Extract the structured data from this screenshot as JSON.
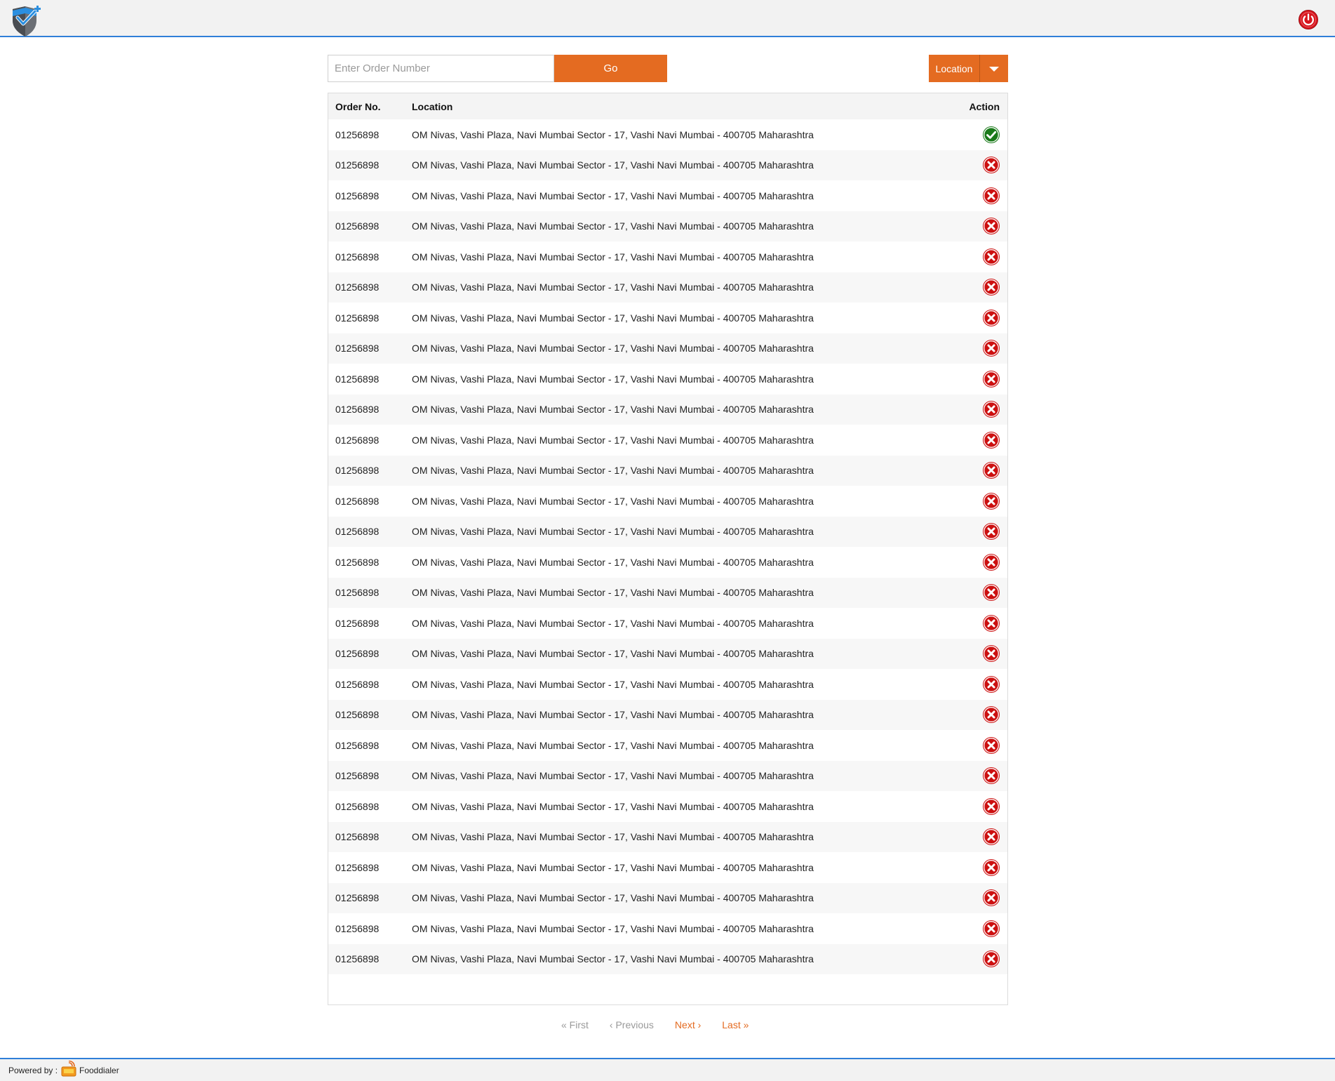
{
  "header": {
    "logo_icon": "shield-check-logo-icon",
    "power_icon": "power-icon"
  },
  "search": {
    "placeholder": "Enter Order Number",
    "value": "",
    "go_label": "Go"
  },
  "location_dropdown": {
    "label": "Location",
    "caret_icon": "caret-down-icon"
  },
  "table": {
    "headers": [
      "Order No.",
      "Location",
      "Action"
    ],
    "rows": [
      {
        "order_no": "01256898",
        "location": "OM Nivas, Vashi Plaza, Navi Mumbai Sector - 17, Vashi Navi Mumbai - 400705 Maharashtra",
        "action": "approved"
      },
      {
        "order_no": "01256898",
        "location": "OM Nivas, Vashi Plaza, Navi Mumbai Sector - 17, Vashi Navi Mumbai - 400705 Maharashtra",
        "action": "rejected"
      },
      {
        "order_no": "01256898",
        "location": "OM Nivas, Vashi Plaza, Navi Mumbai Sector - 17, Vashi Navi Mumbai - 400705 Maharashtra",
        "action": "rejected"
      },
      {
        "order_no": "01256898",
        "location": "OM Nivas, Vashi Plaza, Navi Mumbai Sector - 17, Vashi Navi Mumbai - 400705 Maharashtra",
        "action": "rejected"
      },
      {
        "order_no": "01256898",
        "location": "OM Nivas, Vashi Plaza, Navi Mumbai Sector - 17, Vashi Navi Mumbai - 400705 Maharashtra",
        "action": "rejected"
      },
      {
        "order_no": "01256898",
        "location": "OM Nivas, Vashi Plaza, Navi Mumbai Sector - 17, Vashi Navi Mumbai - 400705 Maharashtra",
        "action": "rejected"
      },
      {
        "order_no": "01256898",
        "location": "OM Nivas, Vashi Plaza, Navi Mumbai Sector - 17, Vashi Navi Mumbai - 400705 Maharashtra",
        "action": "rejected"
      },
      {
        "order_no": "01256898",
        "location": "OM Nivas, Vashi Plaza, Navi Mumbai Sector - 17, Vashi Navi Mumbai - 400705 Maharashtra",
        "action": "rejected"
      },
      {
        "order_no": "01256898",
        "location": "OM Nivas, Vashi Plaza, Navi Mumbai Sector - 17, Vashi Navi Mumbai - 400705 Maharashtra",
        "action": "rejected"
      },
      {
        "order_no": "01256898",
        "location": "OM Nivas, Vashi Plaza, Navi Mumbai Sector - 17, Vashi Navi Mumbai - 400705 Maharashtra",
        "action": "rejected"
      },
      {
        "order_no": "01256898",
        "location": "OM Nivas, Vashi Plaza, Navi Mumbai Sector - 17, Vashi Navi Mumbai - 400705 Maharashtra",
        "action": "rejected"
      },
      {
        "order_no": "01256898",
        "location": "OM Nivas, Vashi Plaza, Navi Mumbai Sector - 17, Vashi Navi Mumbai - 400705 Maharashtra",
        "action": "rejected"
      },
      {
        "order_no": "01256898",
        "location": "OM Nivas, Vashi Plaza, Navi Mumbai Sector - 17, Vashi Navi Mumbai - 400705 Maharashtra",
        "action": "rejected"
      },
      {
        "order_no": "01256898",
        "location": "OM Nivas, Vashi Plaza, Navi Mumbai Sector - 17, Vashi Navi Mumbai - 400705 Maharashtra",
        "action": "rejected"
      },
      {
        "order_no": "01256898",
        "location": "OM Nivas, Vashi Plaza, Navi Mumbai Sector - 17, Vashi Navi Mumbai - 400705 Maharashtra",
        "action": "rejected"
      },
      {
        "order_no": "01256898",
        "location": "OM Nivas, Vashi Plaza, Navi Mumbai Sector - 17, Vashi Navi Mumbai - 400705 Maharashtra",
        "action": "rejected"
      },
      {
        "order_no": "01256898",
        "location": "OM Nivas, Vashi Plaza, Navi Mumbai Sector - 17, Vashi Navi Mumbai - 400705 Maharashtra",
        "action": "rejected"
      },
      {
        "order_no": "01256898",
        "location": "OM Nivas, Vashi Plaza, Navi Mumbai Sector - 17, Vashi Navi Mumbai - 400705 Maharashtra",
        "action": "rejected"
      },
      {
        "order_no": "01256898",
        "location": "OM Nivas, Vashi Plaza, Navi Mumbai Sector - 17, Vashi Navi Mumbai - 400705 Maharashtra",
        "action": "rejected"
      },
      {
        "order_no": "01256898",
        "location": "OM Nivas, Vashi Plaza, Navi Mumbai Sector - 17, Vashi Navi Mumbai - 400705 Maharashtra",
        "action": "rejected"
      },
      {
        "order_no": "01256898",
        "location": "OM Nivas, Vashi Plaza, Navi Mumbai Sector - 17, Vashi Navi Mumbai - 400705 Maharashtra",
        "action": "rejected"
      },
      {
        "order_no": "01256898",
        "location": "OM Nivas, Vashi Plaza, Navi Mumbai Sector - 17, Vashi Navi Mumbai - 400705 Maharashtra",
        "action": "rejected"
      },
      {
        "order_no": "01256898",
        "location": "OM Nivas, Vashi Plaza, Navi Mumbai Sector - 17, Vashi Navi Mumbai - 400705 Maharashtra",
        "action": "rejected"
      },
      {
        "order_no": "01256898",
        "location": "OM Nivas, Vashi Plaza, Navi Mumbai Sector - 17, Vashi Navi Mumbai - 400705 Maharashtra",
        "action": "rejected"
      },
      {
        "order_no": "01256898",
        "location": "OM Nivas, Vashi Plaza, Navi Mumbai Sector - 17, Vashi Navi Mumbai - 400705 Maharashtra",
        "action": "rejected"
      },
      {
        "order_no": "01256898",
        "location": "OM Nivas, Vashi Plaza, Navi Mumbai Sector - 17, Vashi Navi Mumbai - 400705 Maharashtra",
        "action": "rejected"
      },
      {
        "order_no": "01256898",
        "location": "OM Nivas, Vashi Plaza, Navi Mumbai Sector - 17, Vashi Navi Mumbai - 400705 Maharashtra",
        "action": "rejected"
      },
      {
        "order_no": "01256898",
        "location": "OM Nivas, Vashi Plaza, Navi Mumbai Sector - 17, Vashi Navi Mumbai - 400705 Maharashtra",
        "action": "rejected"
      }
    ]
  },
  "pagination": {
    "first": "« First",
    "previous": "‹ Previous",
    "next": "Next ›",
    "last": "Last »"
  },
  "footer": {
    "powered_by": "Powered by :",
    "brand": "Fooddialer",
    "brand_icon": "fooddialer-logo-icon"
  },
  "colors": {
    "accent": "#e46b21",
    "header_border": "#2f7fd8",
    "approved": "#1a7a1a",
    "rejected": "#cc1010"
  }
}
